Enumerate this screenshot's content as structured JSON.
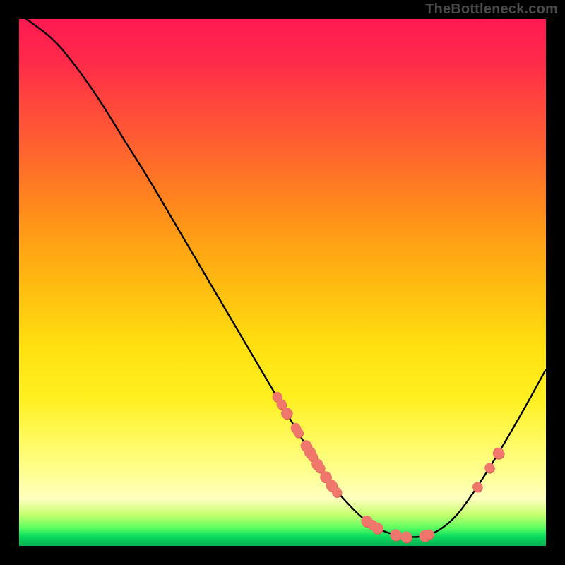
{
  "watermark": "TheBottleneck.com",
  "chart_data": {
    "type": "line",
    "title": "",
    "xlabel": "",
    "ylabel": "",
    "xlim": [
      0,
      1
    ],
    "ylim": [
      0,
      1
    ],
    "curve": [
      {
        "x": 0.0,
        "y": 1.01
      },
      {
        "x": 0.06,
        "y": 0.965
      },
      {
        "x": 0.1,
        "y": 0.92
      },
      {
        "x": 0.15,
        "y": 0.85
      },
      {
        "x": 0.2,
        "y": 0.77
      },
      {
        "x": 0.25,
        "y": 0.69
      },
      {
        "x": 0.3,
        "y": 0.605
      },
      {
        "x": 0.35,
        "y": 0.52
      },
      {
        "x": 0.4,
        "y": 0.435
      },
      {
        "x": 0.45,
        "y": 0.35
      },
      {
        "x": 0.5,
        "y": 0.265
      },
      {
        "x": 0.53,
        "y": 0.215
      },
      {
        "x": 0.56,
        "y": 0.165
      },
      {
        "x": 0.59,
        "y": 0.12
      },
      {
        "x": 0.62,
        "y": 0.085
      },
      {
        "x": 0.65,
        "y": 0.055
      },
      {
        "x": 0.68,
        "y": 0.034
      },
      {
        "x": 0.71,
        "y": 0.022
      },
      {
        "x": 0.74,
        "y": 0.017
      },
      {
        "x": 0.77,
        "y": 0.019
      },
      {
        "x": 0.8,
        "y": 0.032
      },
      {
        "x": 0.83,
        "y": 0.058
      },
      {
        "x": 0.86,
        "y": 0.098
      },
      {
        "x": 0.9,
        "y": 0.16
      },
      {
        "x": 0.95,
        "y": 0.245
      },
      {
        "x": 1.0,
        "y": 0.335
      }
    ],
    "dots": [
      {
        "x": 0.49,
        "y": 0.283,
        "r": 7
      },
      {
        "x": 0.498,
        "y": 0.269,
        "r": 7
      },
      {
        "x": 0.508,
        "y": 0.252,
        "r": 8
      },
      {
        "x": 0.525,
        "y": 0.224,
        "r": 7
      },
      {
        "x": 0.53,
        "y": 0.215,
        "r": 7
      },
      {
        "x": 0.545,
        "y": 0.19,
        "r": 8
      },
      {
        "x": 0.552,
        "y": 0.178,
        "r": 8
      },
      {
        "x": 0.557,
        "y": 0.17,
        "r": 7
      },
      {
        "x": 0.566,
        "y": 0.155,
        "r": 8
      },
      {
        "x": 0.571,
        "y": 0.148,
        "r": 7
      },
      {
        "x": 0.582,
        "y": 0.131,
        "r": 8
      },
      {
        "x": 0.593,
        "y": 0.115,
        "r": 8
      },
      {
        "x": 0.603,
        "y": 0.102,
        "r": 7
      },
      {
        "x": 0.66,
        "y": 0.047,
        "r": 8
      },
      {
        "x": 0.671,
        "y": 0.04,
        "r": 7
      },
      {
        "x": 0.68,
        "y": 0.034,
        "r": 8
      },
      {
        "x": 0.715,
        "y": 0.021,
        "r": 8
      },
      {
        "x": 0.735,
        "y": 0.017,
        "r": 8
      },
      {
        "x": 0.77,
        "y": 0.019,
        "r": 8
      },
      {
        "x": 0.778,
        "y": 0.022,
        "r": 7
      },
      {
        "x": 0.87,
        "y": 0.112,
        "r": 7
      },
      {
        "x": 0.893,
        "y": 0.148,
        "r": 7
      },
      {
        "x": 0.91,
        "y": 0.176,
        "r": 8
      }
    ]
  }
}
